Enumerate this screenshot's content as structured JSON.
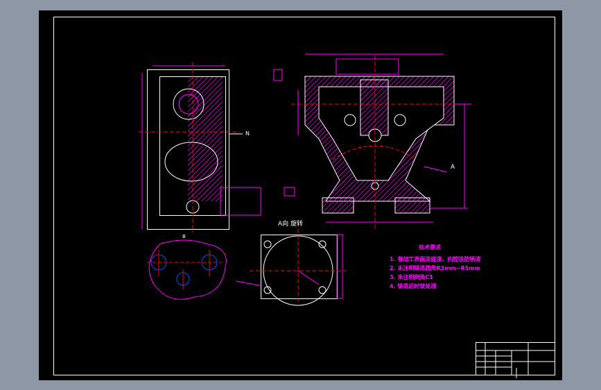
{
  "view_labels": {
    "section_a": "A向 旋转",
    "arrow_a": "A",
    "arrow_n": "N",
    "section_b": "B"
  },
  "requirements": {
    "title": "技术要求",
    "items": [
      "1. 非加工表面涂底漆，内腔涂防锈漆",
      "2. 未注明铸造圆角R3mm~R5mm",
      "3. 未注明倒角C1",
      "4. 铸造后时效处理"
    ]
  },
  "colors": {
    "background": "#000000",
    "outline": "#ffffff",
    "dimension": "#ff00ff",
    "centerline": "#ff0000",
    "frame": "#8e97a6"
  }
}
